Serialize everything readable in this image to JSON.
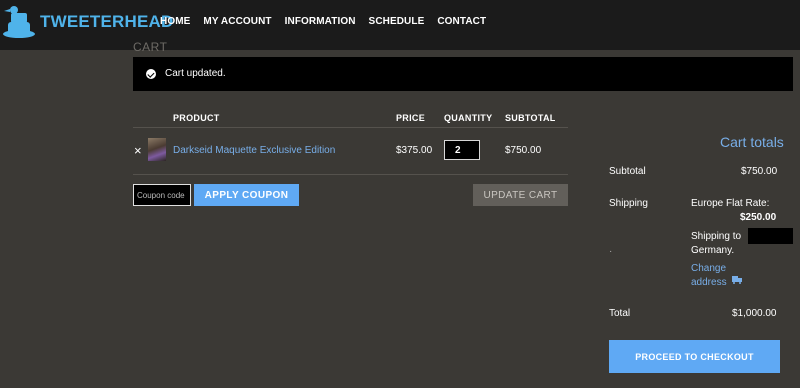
{
  "brand": {
    "name": "TWEETERHEAD",
    "accent": "#4fb3ea"
  },
  "nav": [
    "HOME",
    "MY ACCOUNT",
    "INFORMATION",
    "SCHEDULE",
    "CONTACT"
  ],
  "page": {
    "title": "CART"
  },
  "notice": {
    "message": "Cart updated.",
    "icon": "check-circle-icon"
  },
  "table": {
    "headers": {
      "product": "PRODUCT",
      "price": "PRICE",
      "quantity": "QUANTITY",
      "subtotal": "SUBTOTAL"
    },
    "rows": [
      {
        "remove": "×",
        "name": "Darkseid Maquette Exclusive Edition",
        "price": "$375.00",
        "quantity": "2",
        "subtotal": "$750.00"
      }
    ]
  },
  "actions": {
    "coupon_placeholder": "Coupon code",
    "apply_label": "APPLY COUPON",
    "update_label": "UPDATE CART"
  },
  "totals": {
    "title": "Cart totals",
    "subtotal_label": "Subtotal",
    "subtotal_value": "$750.00",
    "shipping_label": "Shipping",
    "shipping_method": "Europe Flat Rate:",
    "shipping_amount": "$250.00",
    "shipping_to": "Shipping to",
    "shipping_country": "Germany.",
    "change_line1": "Change",
    "change_line2": "address",
    "total_label": "Total",
    "total_value": "$1,000.00",
    "checkout_label": "PROCEED TO CHECKOUT"
  },
  "colors": {
    "background": "#3b3935",
    "topbar": "#1b1b1b",
    "button_primary": "#5fa9f4",
    "link": "#78aee8"
  }
}
